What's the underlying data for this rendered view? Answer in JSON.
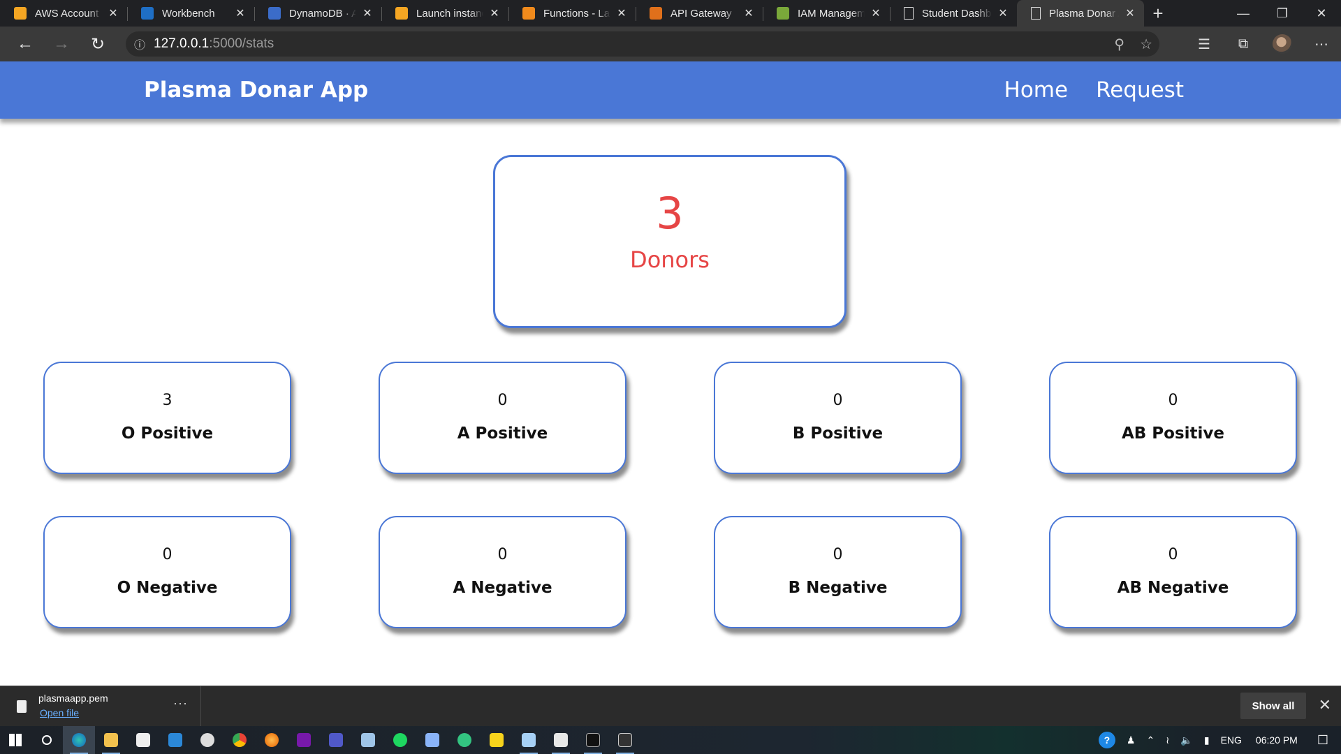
{
  "browser": {
    "tabs": [
      {
        "title": "AWS Account",
        "icon": "aws-icon",
        "color": "#f5a623"
      },
      {
        "title": "Workbench",
        "icon": "vocareum-icon",
        "color": "#1f6fc5"
      },
      {
        "title": "DynamoDB · AWS",
        "icon": "dynamodb-icon",
        "color": "#3b6cc9"
      },
      {
        "title": "Launch instance",
        "icon": "aws-icon",
        "color": "#f5a623"
      },
      {
        "title": "Functions - Lambda",
        "icon": "lambda-icon",
        "color": "#f08a1c"
      },
      {
        "title": "API Gateway",
        "icon": "api-gateway-icon",
        "color": "#e0701b"
      },
      {
        "title": "IAM Management",
        "icon": "iam-icon",
        "color": "#7aa83a"
      },
      {
        "title": "Student Dashboard",
        "icon": "document-icon",
        "color": "#dddddd"
      },
      {
        "title": "Plasma Donar App",
        "icon": "document-icon",
        "color": "#dddddd",
        "active": true
      }
    ],
    "url_host": "127.0.0.1",
    "url_path": ":5000/stats"
  },
  "app": {
    "brand": "Plasma Donar App",
    "nav": {
      "home": "Home",
      "request": "Request"
    },
    "total": {
      "count": "3",
      "label": "Donors"
    },
    "groups": [
      {
        "count": "3",
        "label": "O Positive"
      },
      {
        "count": "0",
        "label": "A Positive"
      },
      {
        "count": "0",
        "label": "B Positive"
      },
      {
        "count": "0",
        "label": "AB Positive"
      },
      {
        "count": "0",
        "label": "O Negative"
      },
      {
        "count": "0",
        "label": "A Negative"
      },
      {
        "count": "0",
        "label": "B Negative"
      },
      {
        "count": "0",
        "label": "AB Negative"
      }
    ]
  },
  "download": {
    "filename": "plasmaapp.pem",
    "open_label": "Open file",
    "show_all": "Show all"
  },
  "tray": {
    "language": "ENG",
    "time": "06:20 PM"
  },
  "colors": {
    "navbar": "#4a77d6",
    "donor_accent": "#e64545"
  }
}
